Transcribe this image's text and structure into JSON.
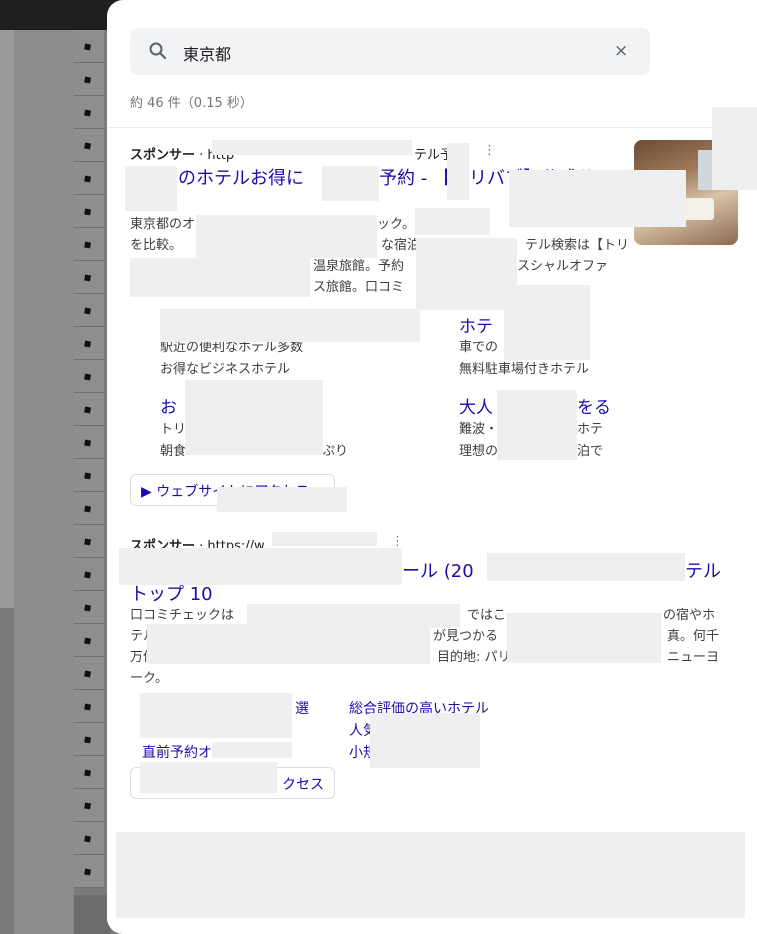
{
  "outer_close": "×",
  "search": {
    "query": "東京都",
    "clear": "×"
  },
  "result_stats": "約 46 件（0.15 秒）",
  "ads": [
    {
      "sponsor": "スポンサー",
      "url_prefix": " · http",
      "url_suffix": "テル予",
      "menu": "⋮",
      "title_left": "のホテルお得に",
      "title_mid": "予約 - 【",
      "title_right": "リバブ】公式サ",
      "snippet": [
        "東京都のオ",
        "ック。お",
        "を比較。",
        "な宿泊",
        "テル検索は【トリ",
        "温泉旅館。予約",
        "スシャルオファ",
        "ス旅館。口コミ"
      ],
      "sitelinks": [
        {
          "title": "",
          "desc": [
            "駅近の便利なホテル多数",
            "お得なビジネスホテル"
          ]
        },
        {
          "title": "ホテ",
          "desc": [
            "車での",
            "無料駐車場付きホテル"
          ]
        },
        {
          "title": "お",
          "desc": [
            "トリ",
            "朝食"
          ]
        },
        {
          "title": "大人",
          "desc": [
            "難波・",
            "理想の"
          ]
        }
      ],
      "sitelink_extras": [
        "をる",
        "ホテ",
        "ぷり",
        "泊で"
      ],
      "visit_button": "ウェブサイトにアクセス"
    },
    {
      "sponsor": "スポンサー",
      "url_prefix": " · https://w",
      "menu": "⋮",
      "title_mid": "ール (20",
      "title_right": "テル",
      "title_line2": "トップ 10",
      "snippet": [
        "口コミチェックは",
        "ではこ",
        "の宿やホ",
        "テル",
        "が見つかる",
        "真。何千",
        "万件",
        "目的地: パリ",
        "ニューヨ",
        "ーク。"
      ],
      "links": [
        "選",
        "総合評価の高いホテル",
        "人気",
        "直前予約オ",
        "小規"
      ],
      "visit_button_suffix": "クセス"
    }
  ]
}
